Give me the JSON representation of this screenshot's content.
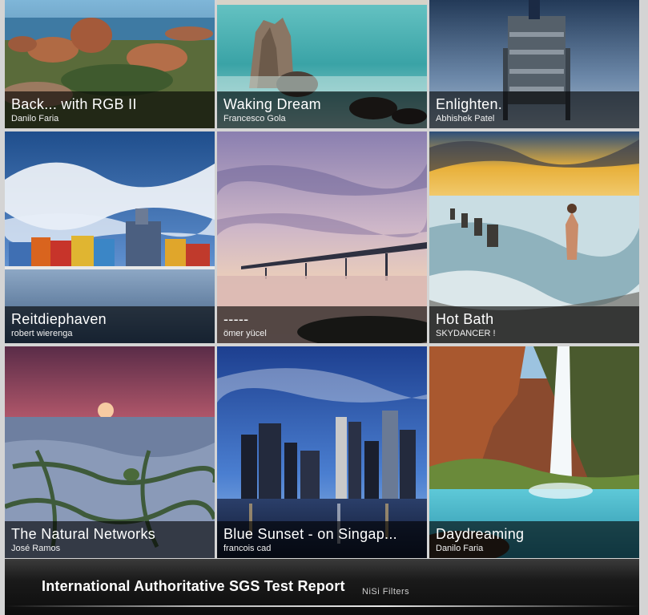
{
  "gallery": {
    "tiles": [
      {
        "title": "Back... with RGB II",
        "author": "Danilo Faria"
      },
      {
        "title": "Waking Dream",
        "author": "Francesco Gola"
      },
      {
        "title": "Enlighten.",
        "author": "Abhishek Patel"
      },
      {
        "title": "Reitdiephaven",
        "author": "robert wierenga"
      },
      {
        "title": "-----",
        "author": "ömer yücel"
      },
      {
        "title": "Hot Bath",
        "author": "SKYDANCER !"
      },
      {
        "title": "The Natural Networks",
        "author": "José Ramos"
      },
      {
        "title": "Blue Sunset - on Singap...",
        "author": "francois cad"
      },
      {
        "title": "Daydreaming",
        "author": "Danilo Faria"
      }
    ]
  },
  "banner": {
    "heading": "International Authoritative SGS Test Report",
    "brand": "NiSi Filters"
  }
}
